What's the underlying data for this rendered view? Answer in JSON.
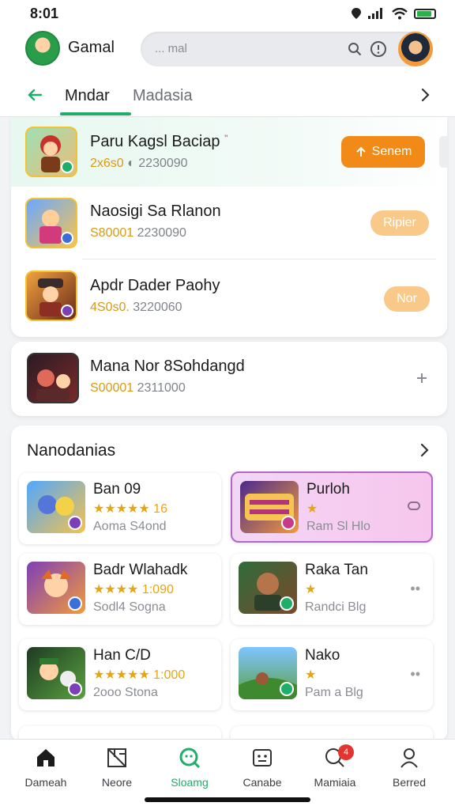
{
  "status_bar": {
    "time": "8:01"
  },
  "header": {
    "app_name": "Gamal",
    "search_placeholder": "... mal"
  },
  "tabs": [
    {
      "label": "Mndar",
      "active": true
    },
    {
      "label": "Madasia",
      "active": false
    }
  ],
  "ranked_list": [
    {
      "title": "Paru Kagsl Baciap",
      "mark": "\"",
      "meta_gold": "2x6s0",
      "meta_icon": "◐",
      "meta_count": "2230090",
      "button_label": "Senem",
      "button_style": "primary"
    },
    {
      "title": "Naosigi Sa Rlanon",
      "meta_gold": "S80001",
      "meta_count": "2230090",
      "button_label": "Ripier",
      "button_style": "soft"
    },
    {
      "title": "Apdr Dader Paohy",
      "meta_gold": "4S0s0.",
      "meta_count": "3220060",
      "button_label": "Nor",
      "button_style": "soft"
    }
  ],
  "single_item": {
    "title": "Mana Nor 8Sohdangd",
    "meta_gold": "S00001",
    "meta_count": "2311000"
  },
  "section": {
    "title": "Nanodanias",
    "tiles": [
      {
        "title": "Ban 09",
        "stars": "★★★★★",
        "rating": "16",
        "sub": "Aoma S4ond",
        "selected": false
      },
      {
        "title": "Purloh",
        "stars": "★",
        "rating": "",
        "sub": "Ram Sl Hlo",
        "selected": true
      },
      {
        "title": "Badr Wlahadk",
        "stars": "★★★★",
        "rating": "1:090",
        "sub": "Sodl4 Sogna",
        "selected": false
      },
      {
        "title": "Raka Tan",
        "stars": "★",
        "rating": "",
        "sub": "Randci Blg",
        "selected": false
      },
      {
        "title": "Han C/D",
        "stars": "★★★★★",
        "rating": "1:000",
        "sub": "2ooo Stona",
        "selected": false
      },
      {
        "title": "Nako",
        "stars": "★",
        "rating": "",
        "sub": "Pam a Blg",
        "selected": false
      }
    ]
  },
  "bottom_nav": [
    {
      "label": "Dameah",
      "icon": "home-icon",
      "active": false
    },
    {
      "label": "Neore",
      "icon": "news-icon",
      "active": false
    },
    {
      "label": "Sloamg",
      "icon": "search-icon",
      "active": true
    },
    {
      "label": "Canabe",
      "icon": "robot-icon",
      "active": false
    },
    {
      "label": "Mamiaia",
      "icon": "notification-icon",
      "active": false,
      "badge": "4"
    },
    {
      "label": "Berred",
      "icon": "profile-icon",
      "active": false
    }
  ],
  "colors": {
    "accent": "#1eae6a",
    "orange": "#f28a18",
    "gold": "#d89a14"
  }
}
